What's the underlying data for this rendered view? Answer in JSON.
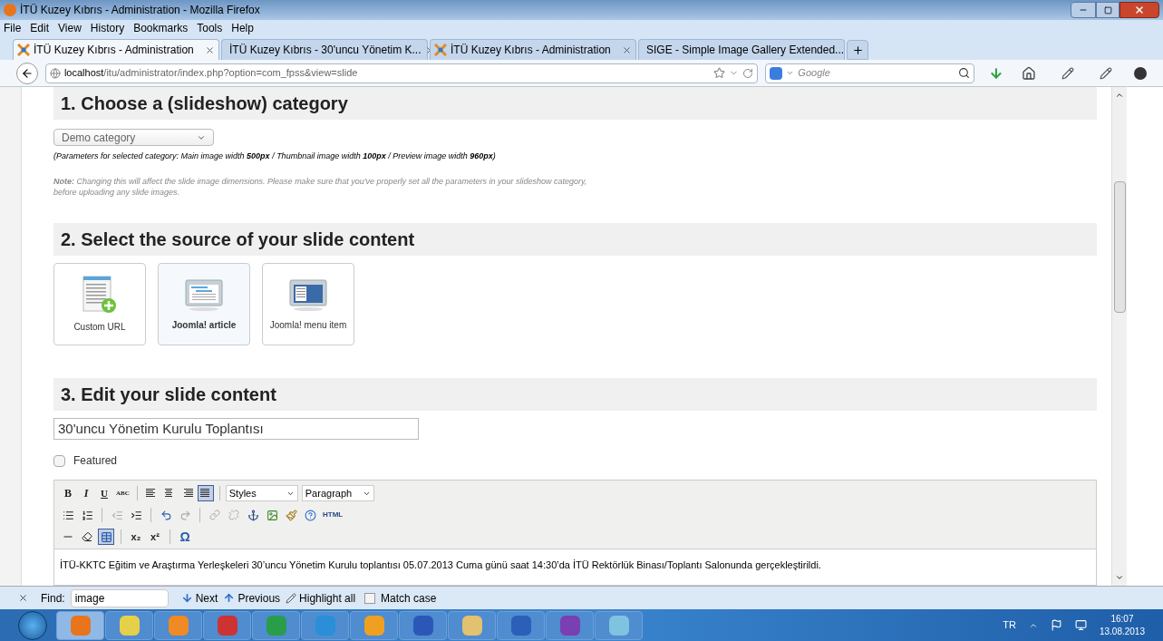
{
  "window": {
    "title": "İTÜ Kuzey Kıbrıs - Administration - Mozilla Firefox"
  },
  "menu": [
    "File",
    "Edit",
    "View",
    "History",
    "Bookmarks",
    "Tools",
    "Help"
  ],
  "tabs": [
    {
      "label": "İTÜ Kuzey Kıbrıs - Administration",
      "selected": true
    },
    {
      "label": "İTÜ Kuzey Kıbrıs - 30'uncu Yönetim K...",
      "selected": false
    },
    {
      "label": "İTÜ Kuzey Kıbrıs - Administration",
      "selected": false
    },
    {
      "label": "SIGE - Simple Image Gallery Extended...",
      "selected": false
    }
  ],
  "address": {
    "host": "localhost",
    "path": "/itu/administrator/index.php?option=com_fpss&view=slide"
  },
  "search": {
    "placeholder": "Google"
  },
  "sections": [
    {
      "heading": "1. Choose a (slideshow) category"
    },
    {
      "heading": "2. Select the source of your slide content"
    },
    {
      "heading": "3. Edit your slide content"
    }
  ],
  "category": {
    "value": "Demo category",
    "params": "(Parameters for selected category: Main image width **500px** / Thumbnail image width **100px** / Preview image width **960px**)",
    "note": "**Note:** Changing this will affect the slide image dimensions. Please make sure that you've properly set all the parameters in your slideshow category, before uploading any slide images."
  },
  "sources": [
    {
      "label": "Custom URL",
      "selected": false
    },
    {
      "label": "Joomla! article",
      "selected": true
    },
    {
      "label": "Joomla! menu item",
      "selected": false
    }
  ],
  "slide": {
    "title": "30'uncu Yönetim Kurulu Toplantısı",
    "featured": {
      "label": "Featured",
      "checked": false
    }
  },
  "editor": {
    "format": [
      "B",
      "I",
      "U",
      "ABC"
    ],
    "align": [
      {
        "selected": false
      },
      {
        "selected": false
      },
      {
        "selected": false
      },
      {
        "selected": true
      }
    ],
    "styles": "Styles",
    "paragraph": "Paragraph",
    "html": "HTML",
    "table_active": true,
    "sub": "x₂",
    "sup": "x²",
    "omega": "Ω",
    "content": "İTÜ-KKTC Eğitim ve Araştırma Yerleşkeleri 30’uncu Yönetim Kurulu toplantısı 05.07.2013 Cuma günü saat 14:30’da İTÜ Rektörlük Binası/Toplantı Salonunda gerçekleştirildi."
  },
  "find_bar": {
    "label": "Find:",
    "value": "image",
    "next": "Next",
    "previous": "Previous",
    "highlight": "Highlight all",
    "match_case": {
      "label": "Match case",
      "checked": false
    }
  },
  "tray": {
    "language": "TR",
    "time": "16:07",
    "date": "13.08.2013"
  }
}
